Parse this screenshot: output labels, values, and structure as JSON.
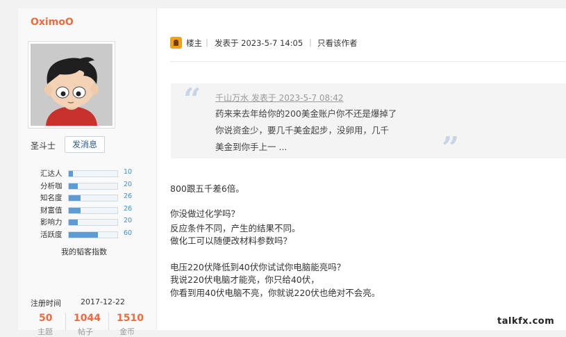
{
  "user": {
    "name": "OximoO",
    "rank": "圣斗士",
    "message_button": "发消息",
    "stats": [
      {
        "label": "汇达人",
        "value": "10",
        "fraction": 0.09
      },
      {
        "label": "分析咖",
        "value": "20",
        "fraction": 0.18
      },
      {
        "label": "知名度",
        "value": "26",
        "fraction": 0.24
      },
      {
        "label": "财富值",
        "value": "26",
        "fraction": 0.24
      },
      {
        "label": "影响力",
        "value": "20",
        "fraction": 0.18
      },
      {
        "label": "活跃度",
        "value": "60",
        "fraction": 0.6
      }
    ],
    "index_link": "我的韬客指数",
    "register_label": "注册时间",
    "register_date": "2017-12-22",
    "counts": [
      {
        "value": "50",
        "label": "主题"
      },
      {
        "value": "1044",
        "label": "帖子"
      },
      {
        "value": "1510",
        "label": "金币"
      }
    ]
  },
  "post": {
    "host_label": "楼主",
    "sep": "|",
    "posted_at": "发表于 2023-5-7 14:05",
    "only_author": "只看该作者",
    "quote": {
      "header": "千山万水 发表于 2023-5-7 08:42",
      "lines": [
        "药来来去年给你的200美金账户你不还是爆掉了",
        "你说资金少，要几千美金起步，没卵用，几千",
        "美金到你手上一 ..."
      ]
    },
    "lines": [
      "800跟五千差6倍。",
      "你没做过化学吗？",
      "反应条件不同，产生的结果不同。",
      "做化工可以随便改材料参数吗？",
      "电压220伏降低到40伏你试试你电脑能亮吗？",
      "我说220伏电脑才能亮，你只给40伏，",
      "你看到用40伏电脑不亮，你就说220伏也绝对不会亮。"
    ]
  },
  "watermark": "talkfx.com"
}
